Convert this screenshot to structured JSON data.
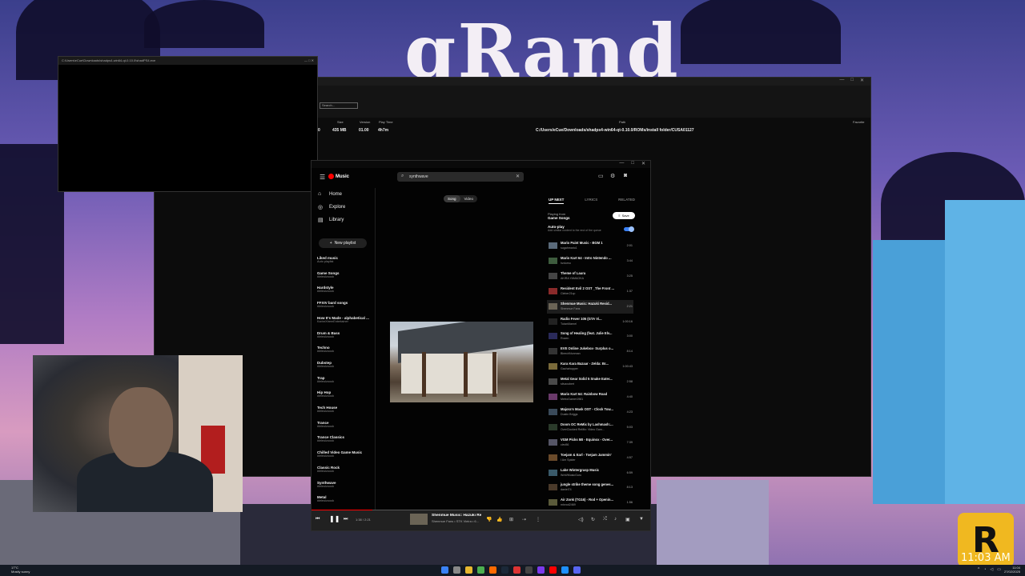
{
  "wallpaper": {
    "logo_text": "gRand",
    "corner_logo": "R",
    "hud_time": "11:03 AM"
  },
  "console": {
    "title": "C:\\Users\\eCue\\Downloads\\shadps4-win64-qt-0.10.0\\shadPS4.exe"
  },
  "emulator": {
    "search_placeholder": "Search...",
    "columns": {
      "size": "Size",
      "version": "Version",
      "play_time": "Play Time",
      "path": "Path",
      "favorite": "Favorite"
    },
    "row": {
      "icon": "0",
      "size": "435 MB",
      "version": "01.00",
      "play_time": "4h7m",
      "path": "C:/Users/eCue/Downloads/shadps4-win64-qt-0.10.0/ROMs/install folder/CUSA01127"
    }
  },
  "ytmusic": {
    "brand": "Music",
    "search_value": "synthwave",
    "nav": [
      {
        "label": "Home",
        "icon": "home-icon",
        "glyph": "⌂"
      },
      {
        "label": "Explore",
        "icon": "explore-icon",
        "glyph": "◎"
      },
      {
        "label": "Library",
        "icon": "library-icon",
        "glyph": "▤"
      }
    ],
    "new_playlist": "New playlist",
    "playlists": [
      {
        "title": "Liked music",
        "subtitle": "Auto playlist"
      },
      {
        "title": "Game Songs",
        "subtitle": "#leleulzoook"
      },
      {
        "title": "Hardstyle",
        "subtitle": "#leleulzoook"
      },
      {
        "title": "FFXIV bard songs",
        "subtitle": "#leleulzoook"
      },
      {
        "title": "How It's Made - alphabetical ...",
        "subtitle": "KarinrXtremEntertainer"
      },
      {
        "title": "Drum & Bass",
        "subtitle": "#leleulzoook"
      },
      {
        "title": "Techno",
        "subtitle": "#leleulzoook"
      },
      {
        "title": "Dubstep",
        "subtitle": "#leleulzoook"
      },
      {
        "title": "Trap",
        "subtitle": "#leleulzoook"
      },
      {
        "title": "Hip Hop",
        "subtitle": "#leleulzoook"
      },
      {
        "title": "Tech House",
        "subtitle": "#leleulzoook"
      },
      {
        "title": "Trance",
        "subtitle": "#leleulzoook"
      },
      {
        "title": "Trance Classics",
        "subtitle": "#leleulzoook"
      },
      {
        "title": "Chilled Video Game Music",
        "subtitle": "#leleulzoook"
      },
      {
        "title": "Classic Rock",
        "subtitle": "#leleulzoook"
      },
      {
        "title": "Synthwave",
        "subtitle": "#leleulzoook"
      },
      {
        "title": "Metal",
        "subtitle": "#leleulzoook"
      }
    ],
    "toggle": {
      "song": "Song",
      "video": "Video"
    },
    "queue_tabs": {
      "up_next": "UP NEXT",
      "lyrics": "LYRICS",
      "related": "RELATED"
    },
    "playing_from_label": "Playing from",
    "playing_from": "Game Songs",
    "save_label": "Save",
    "autoplay_label": "Auto-play",
    "autoplay_desc": "Add similar content to the end of the queue",
    "queue": [
      {
        "title": "Mario Paint Music - BGM 1",
        "artist": "sugahmario1",
        "duration": "2:01"
      },
      {
        "title": "Mario Kart 64 - Intro Nintendo ...",
        "artist": "hzdumu",
        "duration": "3:44"
      },
      {
        "title": "Theme of Laura",
        "artist": "AKIRA YAMAOKA",
        "duration": "3:25"
      },
      {
        "title": "Resident Evil 2 OST _The Front ...",
        "artist": "Cleber21cp",
        "duration": "1:37"
      },
      {
        "title": "Shenmue Music: Hazuki Resid...",
        "artist": "Shenmue Fans",
        "duration": "2:21"
      },
      {
        "title": "Radio Fever 105 (GTA Vi...",
        "artist": "TutanMarnel",
        "duration": "1:00:16"
      },
      {
        "title": "Song of Healing (feat. Julie Elv...",
        "artist": "Rozen",
        "duration": "3:00"
      },
      {
        "title": "EVE Online Jukebox- Surplus o...",
        "artist": "BleechNunman",
        "duration": "8:14"
      },
      {
        "title": "Kara Kara Bazaar - Zelda: Br...",
        "artist": "Gachahopper",
        "duration": "1:00:43"
      },
      {
        "title": "Metal Gear Solid 5 Snake Eater...",
        "artist": "silvaxobert",
        "duration": "2:58"
      },
      {
        "title": "Mario Kart 64: Rainbow Road",
        "artist": "MetroGamer1981",
        "duration": "4:40"
      },
      {
        "title": "Majora's Mask OST - Clock Tow...",
        "artist": "Dustin Briggs",
        "duration": "4:23"
      },
      {
        "title": "Doom OC ReMix by Lashmash:...",
        "artist": "OverClocked ReMix: Video Gam...",
        "duration": "5:03"
      },
      {
        "title": "VGM Picks 5B - Equinox - Over...",
        "artist": "clev56",
        "duration": "7:39"
      },
      {
        "title": "Toejam & Earl - Toejam Jammin'",
        "artist": "I Am Spider",
        "duration": "4:57"
      },
      {
        "title": "Lake Wintergrasp Music",
        "artist": "WoWMusicGuru",
        "duration": "6:59"
      },
      {
        "title": "jungle strike theme song genes...",
        "artist": "daniel74",
        "duration": "8:13"
      },
      {
        "title": "Air Zonk (TG16) - Rod + Openin...",
        "artist": "mixrod2469",
        "duration": "1:56"
      }
    ],
    "current_index": 4,
    "player": {
      "time": "1:38 / 2:21",
      "title": "Shenmue Music: Hazuki Re...",
      "artist": "Shenmue Fans • STK Vieira • 6...",
      "progress": 0.18
    }
  },
  "taskbar": {
    "weather_temp": "17°C",
    "weather_desc": "Mostly sunny",
    "time": "11:04",
    "date": "27/02/2025"
  }
}
